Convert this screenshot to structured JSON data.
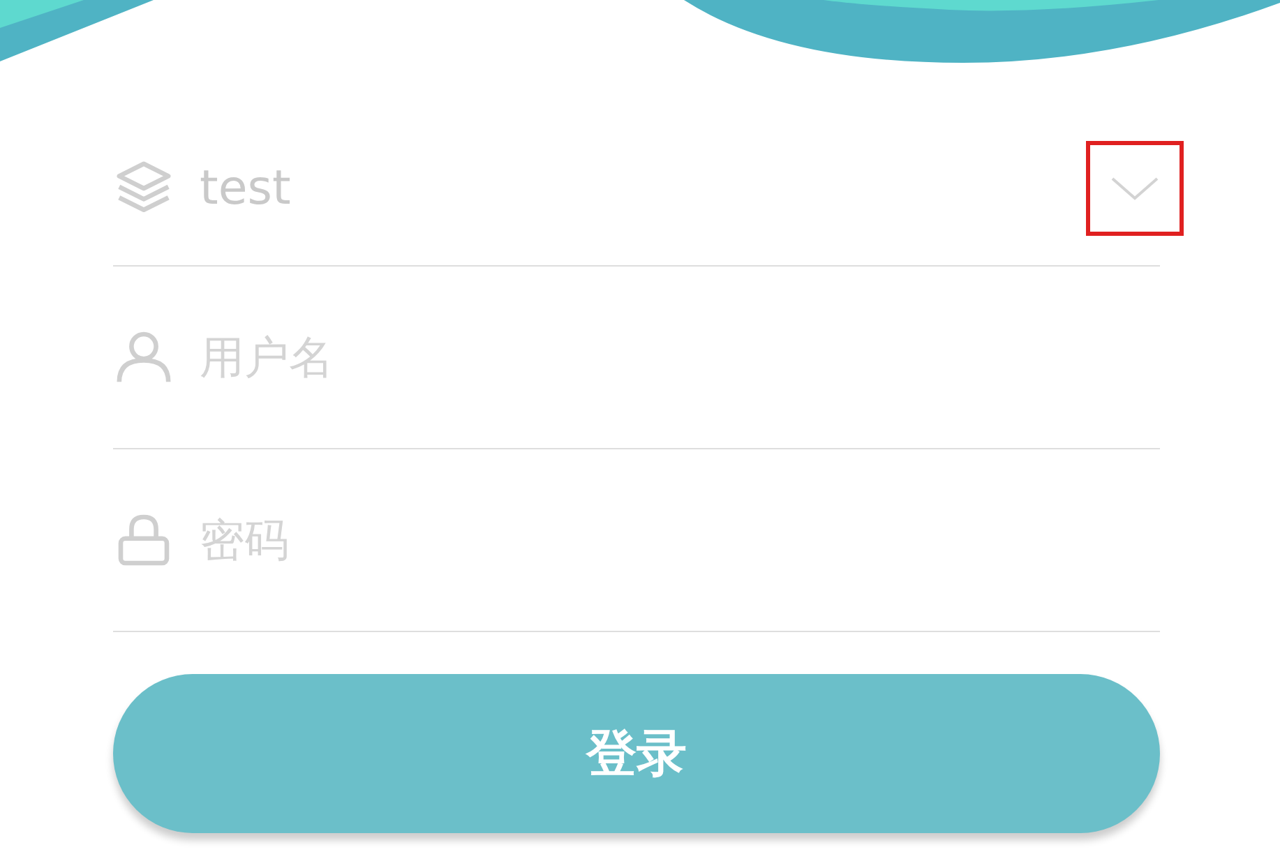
{
  "fields": [
    {
      "kind": "select",
      "value": "test"
    },
    {
      "kind": "user",
      "placeholder": "用户名"
    },
    {
      "kind": "password",
      "placeholder": "密码"
    }
  ],
  "login_button": {
    "label": "登录"
  }
}
